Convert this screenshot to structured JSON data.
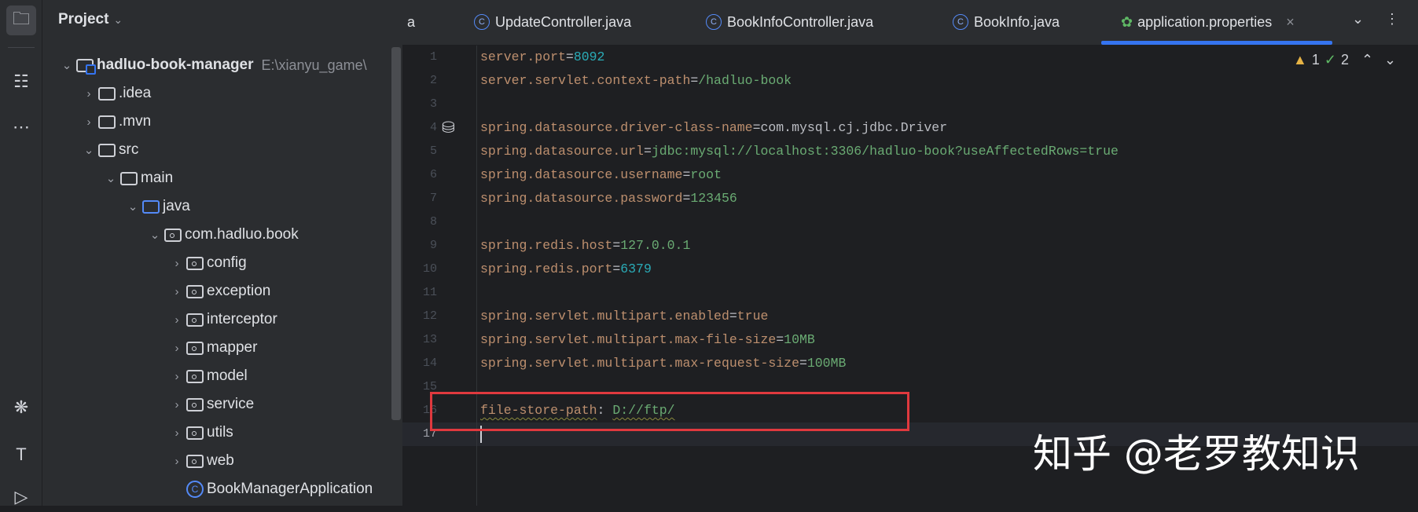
{
  "sidebar": {
    "icons": [
      "folder-icon",
      "structure-icon",
      "more-icon",
      "bug-icon",
      "hammer-icon",
      "run-icon"
    ]
  },
  "project": {
    "title": "Project",
    "root": {
      "name": "hadluo-book-manager",
      "path": "E:\\xianyu_game\\"
    },
    "items": [
      ".idea",
      ".mvn",
      "src",
      "main",
      "java",
      "com.hadluo.book",
      "config",
      "exception",
      "interceptor",
      "mapper",
      "model",
      "service",
      "utils",
      "web",
      "BookManagerApplication"
    ]
  },
  "tabs": [
    {
      "label": "a"
    },
    {
      "label": "UpdateController.java",
      "icon": "C"
    },
    {
      "label": "BookInfoController.java",
      "icon": "C"
    },
    {
      "label": "BookInfo.java",
      "icon": "C"
    },
    {
      "label": "application.properties",
      "active": true,
      "close": "×"
    }
  ],
  "inspections": {
    "warnings": "1",
    "ok": "2"
  },
  "editor": {
    "lines": [
      {
        "k": "server.port",
        "s": "=",
        "v": "8092",
        "t": "n"
      },
      {
        "k": "server.servlet.context-path",
        "s": "=",
        "v": "/hadluo-book",
        "t": "v"
      },
      {
        "k": "",
        "s": "",
        "v": ""
      },
      {
        "k": "spring.datasource.driver-class-name",
        "s": "=",
        "v": "com.mysql.cj.jdbc.Driver",
        "t": "w"
      },
      {
        "k": "spring.datasource.url",
        "s": "=",
        "v": "jdbc:mysql://localhost:3306/hadluo-book?useAffectedRows=true",
        "t": "v"
      },
      {
        "k": "spring.datasource.username",
        "s": "=",
        "v": "root",
        "t": "v"
      },
      {
        "k": "spring.datasource.password",
        "s": "=",
        "v": "123456",
        "t": "v"
      },
      {
        "k": "",
        "s": "",
        "v": ""
      },
      {
        "k": "spring.redis.host",
        "s": "=",
        "v": "127.0.0.1",
        "t": "v"
      },
      {
        "k": "spring.redis.port",
        "s": "=",
        "v": "6379",
        "t": "n"
      },
      {
        "k": "",
        "s": "",
        "v": ""
      },
      {
        "k": "spring.servlet.multipart.enabled",
        "s": "=",
        "v": "true",
        "t": "k"
      },
      {
        "k": "spring.servlet.multipart.max-file-size",
        "s": "=",
        "v": "10MB",
        "t": "v"
      },
      {
        "k": "spring.servlet.multipart.max-request-size",
        "s": "=",
        "v": "100MB",
        "t": "v"
      },
      {
        "k": "",
        "s": "",
        "v": ""
      },
      {
        "k": "file-store-path",
        "s": ": ",
        "v": "D://ftp/",
        "t": "v"
      },
      {
        "k": "",
        "s": "",
        "v": ""
      }
    ]
  },
  "watermark": "知乎 @老罗教知识",
  "colors": {
    "accent": "#3574f0",
    "highlight_box": "#e0393e"
  }
}
